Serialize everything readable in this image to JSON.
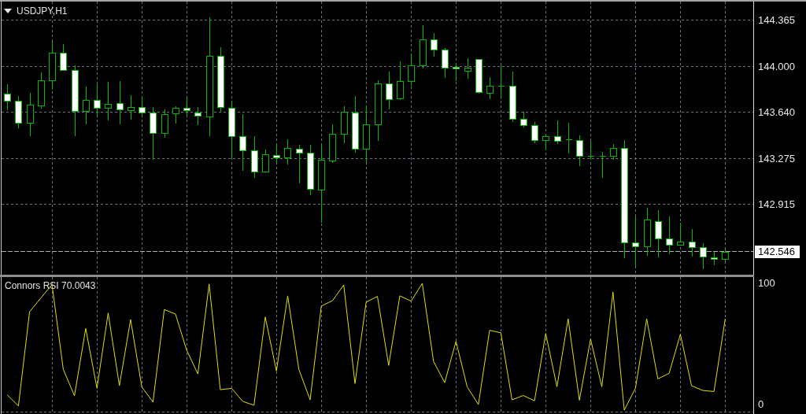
{
  "chart": {
    "chart_data": {
      "type": "candlestick",
      "title": "USDJPY,H1",
      "grid": true,
      "categories": [
        null,
        null,
        null,
        null,
        null,
        null,
        null,
        null,
        null,
        null,
        null,
        null,
        null,
        null,
        null,
        null,
        null,
        null,
        null,
        null,
        null,
        null,
        null,
        null,
        null,
        null,
        null,
        null,
        null,
        null,
        null,
        null,
        null,
        null,
        null,
        null,
        null,
        null,
        null,
        null,
        null,
        null,
        null,
        null,
        null,
        null,
        null,
        null,
        null,
        null,
        null,
        null,
        null,
        null,
        null,
        null,
        null,
        null,
        null,
        null,
        null,
        null,
        null,
        null,
        null,
        null,
        null
      ],
      "ylim": [
        142.365,
        144.512
      ],
      "yticks": [
        {
          "value": 144.365,
          "label": "144.365"
        },
        {
          "value": 144.0,
          "label": "144.000"
        },
        {
          "value": 143.64,
          "label": "143.640"
        },
        {
          "value": 143.275,
          "label": "143.275"
        },
        {
          "value": 142.915,
          "label": "142.915"
        }
      ],
      "ohlc": [
        [
          143.788,
          143.862,
          143.658,
          143.732
        ],
        [
          143.732,
          143.769,
          143.515,
          143.559
        ],
        [
          143.559,
          143.794,
          143.454,
          143.701
        ],
        [
          143.695,
          143.955,
          143.67,
          143.893
        ],
        [
          143.893,
          144.196,
          143.819,
          144.109
        ],
        [
          144.109,
          144.178,
          143.967,
          143.973
        ],
        [
          143.973,
          144.01,
          143.454,
          143.652
        ],
        [
          143.652,
          143.843,
          143.546,
          143.738
        ],
        [
          143.738,
          143.862,
          143.615,
          143.676
        ],
        [
          143.676,
          143.881,
          143.577,
          143.707
        ],
        [
          143.713,
          143.887,
          143.546,
          143.664
        ],
        [
          143.658,
          143.775,
          143.584,
          143.683
        ],
        [
          143.683,
          143.763,
          143.608,
          143.639
        ],
        [
          143.639,
          143.683,
          143.268,
          143.478
        ],
        [
          143.478,
          143.664,
          143.441,
          143.627
        ],
        [
          143.633,
          143.689,
          143.553,
          143.676
        ],
        [
          143.676,
          143.763,
          143.615,
          143.658
        ],
        [
          143.639,
          143.683,
          143.54,
          143.615
        ],
        [
          143.608,
          144.388,
          143.454,
          144.085
        ],
        [
          144.085,
          144.153,
          143.639,
          143.683
        ],
        [
          143.676,
          143.732,
          143.274,
          143.454
        ],
        [
          143.454,
          143.627,
          143.181,
          143.342
        ],
        [
          143.342,
          143.454,
          143.126,
          143.175
        ],
        [
          143.175,
          143.348,
          143.169,
          143.311
        ],
        [
          143.305,
          143.392,
          143.243,
          143.287
        ],
        [
          143.287,
          143.429,
          143.231,
          143.361
        ],
        [
          143.355,
          143.386,
          143.082,
          143.324
        ],
        [
          143.324,
          143.386,
          142.99,
          143.039
        ],
        [
          143.033,
          143.392,
          142.773,
          143.268
        ],
        [
          143.262,
          143.546,
          143.243,
          143.472
        ],
        [
          143.472,
          143.689,
          143.398,
          143.645
        ],
        [
          143.639,
          143.769,
          143.324,
          143.355
        ],
        [
          143.355,
          143.695,
          143.249,
          143.546
        ],
        [
          143.546,
          143.893,
          143.417,
          143.868
        ],
        [
          143.868,
          143.961,
          143.664,
          143.744
        ],
        [
          143.751,
          144.041,
          143.738,
          143.887
        ],
        [
          143.887,
          144.103,
          143.85,
          144.01
        ],
        [
          144.01,
          144.326,
          143.986,
          144.215
        ],
        [
          144.215,
          144.264,
          144.079,
          144.134
        ],
        [
          144.134,
          144.147,
          143.911,
          143.992
        ],
        [
          143.998,
          144.029,
          143.887,
          143.986
        ],
        [
          143.967,
          144.066,
          143.905,
          143.992
        ],
        [
          144.06,
          144.06,
          143.788,
          143.8
        ],
        [
          143.794,
          143.918,
          143.744,
          143.85
        ],
        [
          143.847,
          144.01,
          143.744,
          143.85
        ],
        [
          143.85,
          143.961,
          143.565,
          143.59
        ],
        [
          143.59,
          143.645,
          143.522,
          143.54
        ],
        [
          143.54,
          143.565,
          143.398,
          143.423
        ],
        [
          143.423,
          143.472,
          143.342,
          143.454
        ],
        [
          143.454,
          143.577,
          143.392,
          143.417
        ],
        [
          143.429,
          143.559,
          143.318,
          143.429
        ],
        [
          143.423,
          143.46,
          143.219,
          143.299
        ],
        [
          143.299,
          143.417,
          143.268,
          143.299
        ],
        [
          143.299,
          143.33,
          143.126,
          143.299
        ],
        [
          143.299,
          143.392,
          143.268,
          143.361
        ],
        [
          143.361,
          143.423,
          142.495,
          142.618
        ],
        [
          142.618,
          142.823,
          142.433,
          142.587
        ],
        [
          142.587,
          142.891,
          142.513,
          142.798
        ],
        [
          142.785,
          142.872,
          142.501,
          142.649
        ],
        [
          142.649,
          142.823,
          142.526,
          142.6
        ],
        [
          142.6,
          142.773,
          142.6,
          142.625
        ],
        [
          142.625,
          142.724,
          142.507,
          142.581
        ],
        [
          142.581,
          142.612,
          142.408,
          142.507
        ],
        [
          142.501,
          142.544,
          142.439,
          142.488
        ],
        [
          142.488,
          142.563,
          142.47,
          142.546
        ],
        null,
        null
      ],
      "ref_lines": [
        {
          "axis": "y",
          "value": 142.546,
          "label": "142.546"
        }
      ]
    }
  },
  "indicator": {
    "chart_data": {
      "type": "line",
      "title": "Connors RSI 70.0043",
      "grid": true,
      "categories": [
        null,
        null,
        null,
        null,
        null,
        null,
        null,
        null,
        null,
        null,
        null,
        null,
        null,
        null,
        null,
        null,
        null,
        null,
        null,
        null,
        null,
        null,
        null,
        null,
        null,
        null,
        null,
        null,
        null,
        null,
        null,
        null,
        null,
        null,
        null,
        null,
        null,
        null,
        null,
        null,
        null,
        null,
        null,
        null,
        null,
        null,
        null,
        null,
        null,
        null,
        null,
        null,
        null,
        null,
        null,
        null,
        null,
        null,
        null,
        null,
        null,
        null,
        null,
        null,
        null,
        null,
        null
      ],
      "ylim": [
        -7.79,
        105.19
      ],
      "yticks": [
        0,
        100
      ],
      "series": [
        {
          "color": "#e0e000",
          "values": [
            8.0,
            -1.1,
            76.6,
            87.9,
            98.9,
            29.0,
            7.3,
            62.8,
            13.4,
            75.5,
            15.6,
            70.1,
            14.5,
            2.1,
            78.4,
            74.7,
            44.8,
            25.3,
            99.5,
            12.3,
            13.4,
            2.6,
            -0.6,
            72.3,
            27.7,
            89.7,
            29.0,
            3.9,
            81.2,
            85.8,
            98.7,
            17.3,
            84.5,
            89.2,
            32.3,
            89.7,
            85.3,
            100,
            35.5,
            18.1,
            52.2,
            14.7,
            0,
            61.2,
            59.2,
            3.9,
            7.5,
            3.1,
            58.7,
            14.7,
            70.8,
            3.6,
            54.0,
            14.7,
            92.8,
            -4.6,
            13.4,
            70.8,
            21.2,
            25.8,
            57.9,
            15.5,
            11.6,
            10.8,
            70.8,
            null,
            null
          ]
        }
      ]
    }
  }
}
